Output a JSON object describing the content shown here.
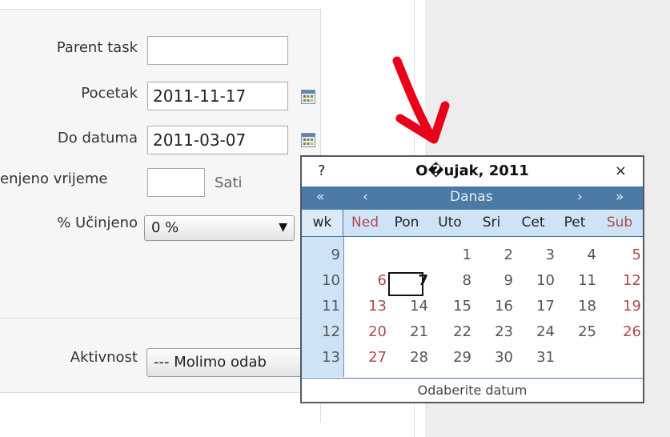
{
  "form": {
    "parent_task_label": "Parent task",
    "parent_task_value": "",
    "pocetak_label": "Pocetak",
    "pocetak_value": "2011-11-17",
    "do_datuma_label": "Do datuma",
    "do_datuma_value": "2011-03-07",
    "vrijeme_label": "enjeno vrijeme",
    "vrijeme_value": "",
    "vrijeme_unit": "Sati",
    "ucinjeno_label": "% Učinjeno",
    "ucinjeno_value": "0 %",
    "aktivnost_label": "Aktivnost",
    "aktivnost_value": "--- Molimo odab"
  },
  "calendar": {
    "help": "?",
    "month_title": "O�ujak, 2011",
    "close": "×",
    "nav": {
      "prev_year": "«",
      "prev_month": "‹",
      "today": "Danas",
      "next_month": "›",
      "next_year": "»"
    },
    "headers": [
      "wk",
      "Ned",
      "Pon",
      "Uto",
      "Sri",
      "Cet",
      "Pet",
      "Sub"
    ],
    "weeks": [
      {
        "wk": "9",
        "days": [
          "",
          "",
          "1",
          "2",
          "3",
          "4",
          "5"
        ]
      },
      {
        "wk": "10",
        "days": [
          "6",
          "7",
          "8",
          "9",
          "10",
          "11",
          "12"
        ]
      },
      {
        "wk": "11",
        "days": [
          "13",
          "14",
          "15",
          "16",
          "17",
          "18",
          "19"
        ]
      },
      {
        "wk": "12",
        "days": [
          "20",
          "21",
          "22",
          "23",
          "24",
          "25",
          "26"
        ]
      },
      {
        "wk": "13",
        "days": [
          "27",
          "28",
          "29",
          "30",
          "31",
          "",
          ""
        ]
      }
    ],
    "selected_day": "7",
    "footer": "Odaberite datum"
  },
  "colors": {
    "nav_bg": "#4b7aa7",
    "header_bg": "#cfe3f7",
    "weekend": "#b04848",
    "arrow": "#e8001a"
  }
}
